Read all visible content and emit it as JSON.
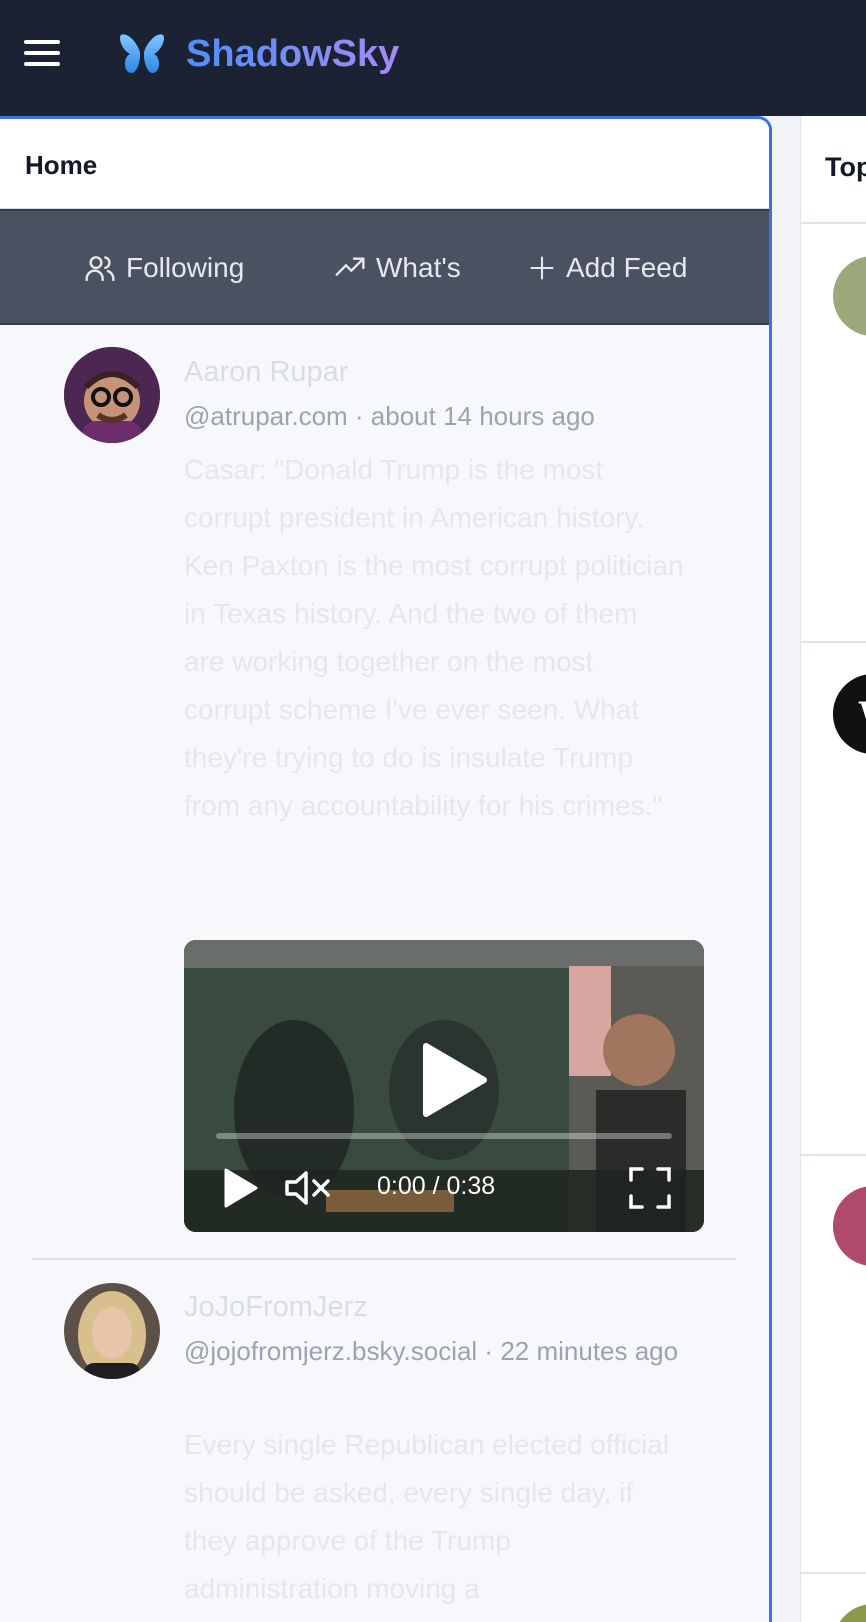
{
  "app": {
    "brand_name": "ShadowSky"
  },
  "main": {
    "header_title": "Home",
    "tabs": [
      {
        "label": "Following",
        "icon": "users-icon"
      },
      {
        "label": "What's",
        "icon": "trending-icon"
      },
      {
        "label": "Add Feed",
        "icon": "plus-icon"
      }
    ],
    "posts": [
      {
        "author": "Aaron Rupar",
        "handle_time": "@atrupar.com · about 14 hours ago",
        "text": "Casar: \"Donald Trump is the most corrupt president in American history. Ken Paxton is the most corrupt politician in Texas history. And the two of them are working together on the most corrupt scheme I've ever seen. What they're trying to do is insulate Trump from any accountability for his crimes.\"",
        "video": {
          "time": "0:00 / 0:38",
          "progress": 0
        }
      },
      {
        "author": "JoJoFromJerz",
        "handle_time": "@jojofromjerz.bsky.social · 22 minutes ago",
        "text": "Every single Republican elected official should be asked, every single day, if they approve of the Trump administration moving a"
      }
    ]
  },
  "right_panel": {
    "title": "Top"
  },
  "colors": {
    "topbar": "#1b2233",
    "accent": "#3b73e6",
    "tabs_bg": "#4a5160",
    "brand_gradient_start": "#4f8ff7",
    "brand_gradient_end": "#a58bf2"
  }
}
